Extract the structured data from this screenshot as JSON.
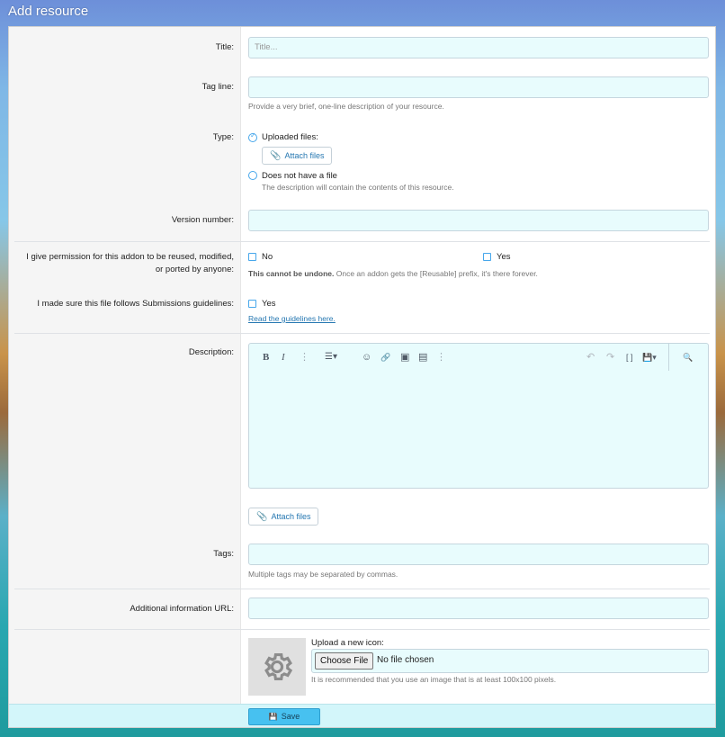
{
  "page": {
    "title": "Add resource"
  },
  "fields": {
    "title": {
      "label": "Title:",
      "placeholder": "Title..."
    },
    "tagline": {
      "label": "Tag line:",
      "hint": "Provide a very brief, one-line description of your resource."
    },
    "type": {
      "label": "Type:",
      "uploaded_label": "Uploaded files:",
      "attach_label": "Attach files",
      "nofile_label": "Does not have a file",
      "nofile_hint": "The description will contain the contents of this resource."
    },
    "version": {
      "label": "Version number:"
    },
    "permission": {
      "label_line1": "I give permission for this addon to be reused, modified,",
      "label_line2": "or ported by anyone:",
      "option_no": "No",
      "option_yes": "Yes",
      "hint_bold": "This cannot be undone.",
      "hint_rest": " Once an addon gets the [Reusable] prefix, it's there forever."
    },
    "guidelines": {
      "label": "I made sure this file follows Submissions guidelines:",
      "option_yes": "Yes",
      "link": "Read the guidelines here."
    },
    "description": {
      "label": "Description:",
      "attach_label": "Attach files"
    },
    "tags": {
      "label": "Tags:",
      "hint": "Multiple tags may be separated by commas."
    },
    "info_url": {
      "label": "Additional information URL:"
    },
    "icon": {
      "upload_label": "Upload a new icon:",
      "choose_label": "Choose File",
      "nofile_text": "No file chosen",
      "hint": "It is recommended that you use an image that is at least 100x100 pixels."
    }
  },
  "toolbar": {
    "bold": "B",
    "italic": "I",
    "more": "⋮",
    "list": "☰▾",
    "emoji": "☺",
    "link": "🔗",
    "image": "▣",
    "media": "▤",
    "undo": "↶",
    "redo": "↷",
    "bbcode": "[ ]",
    "drafts": "💾▾",
    "preview": "🔍"
  },
  "footer": {
    "save_label": "Save"
  },
  "colors": {
    "accent": "#47c1f0",
    "input_bg": "#e8fcfd",
    "link": "#2577b1"
  }
}
